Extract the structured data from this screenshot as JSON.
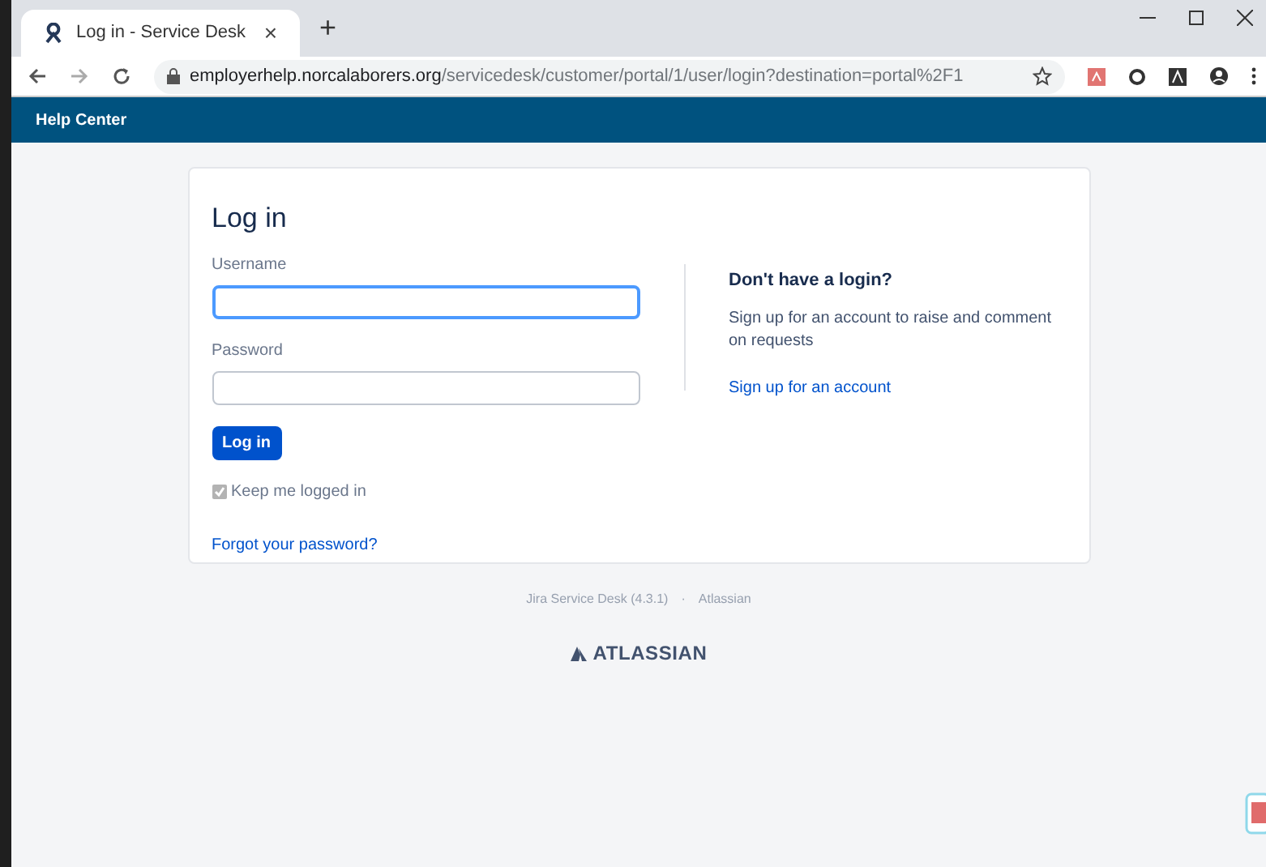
{
  "browser": {
    "tab_title": "Log in - Service Desk",
    "tab_close": "×",
    "new_tab": "+",
    "url_host": "employerhelp.norcalaborers.org",
    "url_path": "/servicedesk/customer/portal/1/user/login?destination=portal%2F1"
  },
  "header": {
    "title": "Help Center"
  },
  "login": {
    "heading": "Log in",
    "username_label": "Username",
    "password_label": "Password",
    "button": "Log in",
    "keep_logged_in": {
      "label": "Keep me logged in",
      "checked": true
    },
    "forgot_link": "Forgot your password?"
  },
  "signup": {
    "heading": "Don't have a login?",
    "text": "Sign up for an account to raise and comment on requests",
    "link": "Sign up for an account"
  },
  "footer": {
    "product": "Jira Service Desk (4.3.1)",
    "separator": "·",
    "vendor": "Atlassian",
    "logo_text": "ATLASSIAN"
  }
}
